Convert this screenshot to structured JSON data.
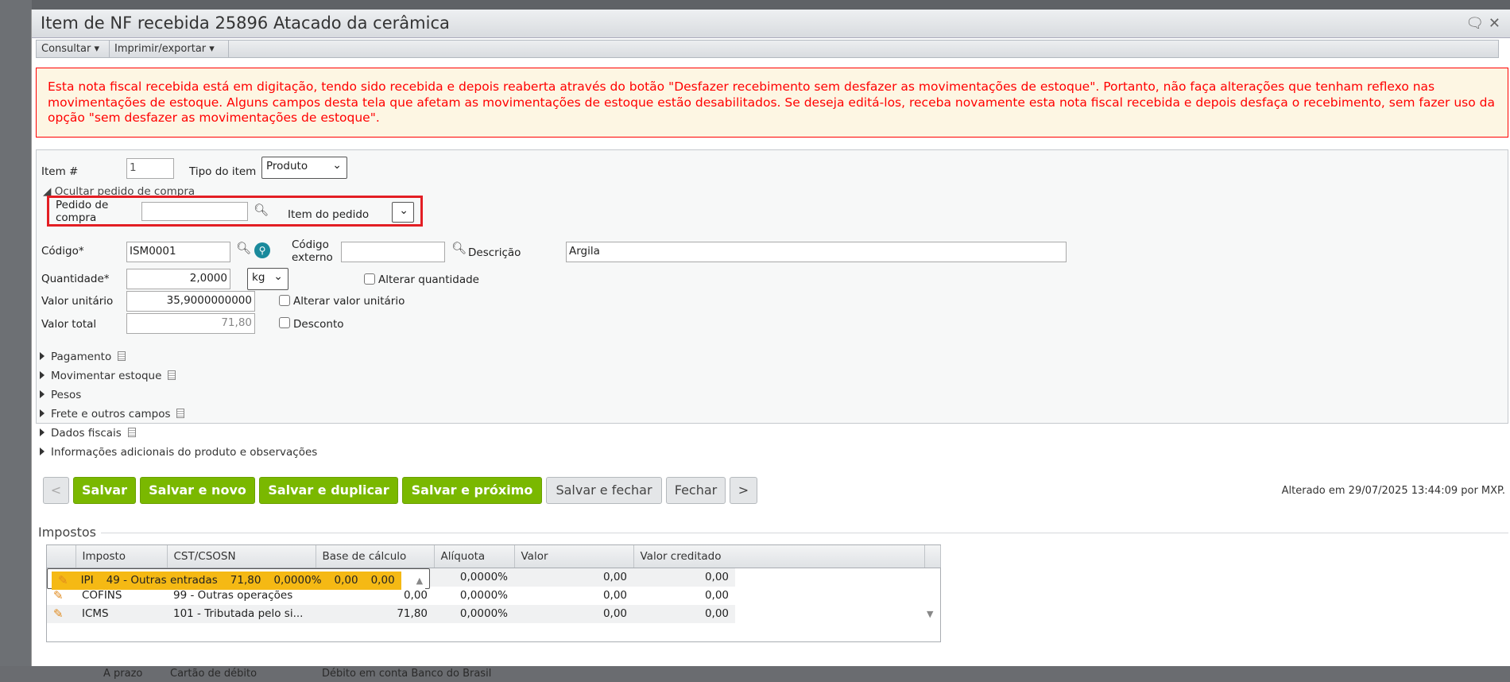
{
  "background": {
    "bottom_fields": [
      "A prazo",
      "Cartão de débito",
      "Débito em conta Banco do Brasil"
    ]
  },
  "dialog": {
    "title": "Item de NF recebida 25896 Atacado da cerâmica"
  },
  "toolbar": {
    "consultar": "Consultar",
    "imprimir": "Imprimir/exportar"
  },
  "warning": "Esta nota fiscal recebida está em digitação, tendo sido recebida e depois reaberta através do botão \"Desfazer recebimento sem desfazer as movimentações de estoque\". Portanto, não faça alterações que tenham reflexo nas movimentações de estoque. Alguns campos desta tela que afetam as movimentações de estoque estão desabilitados. Se deseja editá-los, receba novamente esta nota fiscal recebida e depois desfaça o recebimento, sem fazer uso da opção \"sem desfazer as movimentações de estoque\".",
  "form": {
    "item_label": "Item #",
    "item_value": "1",
    "tipo_label": "Tipo do item",
    "tipo_value": "Produto",
    "ocultar": "Ocultar pedido de compra",
    "pedido_label": "Pedido de compra",
    "pedido_value": "",
    "item_pedido_label": "Item do pedido",
    "codigo_label": "Código*",
    "codigo_value": "ISM0001",
    "codigo_externo_label": "Código externo",
    "codigo_externo_value": "",
    "descricao_label": "Descrição",
    "descricao_value": "Argila",
    "quantidade_label": "Quantidade*",
    "quantidade_value": "2,0000",
    "unidade": "kg",
    "alterar_quantidade": "Alterar quantidade",
    "valor_unitario_label": "Valor unitário",
    "valor_unitario_value": "35,9000000000",
    "alterar_valor_unitario": "Alterar valor unitário",
    "valor_total_label": "Valor total",
    "valor_total_value": "71,80",
    "desconto": "Desconto"
  },
  "sections": [
    "Pagamento",
    "Movimentar estoque",
    "Pesos",
    "Frete e outros campos",
    "Dados fiscais",
    "Informações adicionais do produto e observações"
  ],
  "buttons": {
    "prev": "<",
    "salvar": "Salvar",
    "salvar_novo": "Salvar e novo",
    "salvar_duplicar": "Salvar e duplicar",
    "salvar_proximo": "Salvar e próximo",
    "salvar_fechar": "Salvar e fechar",
    "fechar": "Fechar",
    "next": ">"
  },
  "alterado": "Alterado em 29/07/2025 13:44:09 por MXP.",
  "impostos": {
    "title": "Impostos",
    "columns": [
      "Imposto",
      "CST/CSOSN",
      "Base de cálculo",
      "Alíquota",
      "Valor",
      "Valor creditado"
    ],
    "rows": [
      [
        "IPI",
        "49 - Outras entradas",
        "71,80",
        "0,0000%",
        "0,00",
        "0,00"
      ],
      [
        "PIS",
        "99 - Outras operações",
        "0,00",
        "0,0000%",
        "0,00",
        "0,00"
      ],
      [
        "COFINS",
        "99 - Outras operações",
        "0,00",
        "0,0000%",
        "0,00",
        "0,00"
      ],
      [
        "ICMS",
        "101 - Tributada pelo si...",
        "71,80",
        "0,0000%",
        "0,00",
        "0,00"
      ]
    ]
  },
  "colors": {
    "accent_green": "#7ab800",
    "warning_red": "#ff0000",
    "selected_row": "#f5b914"
  }
}
